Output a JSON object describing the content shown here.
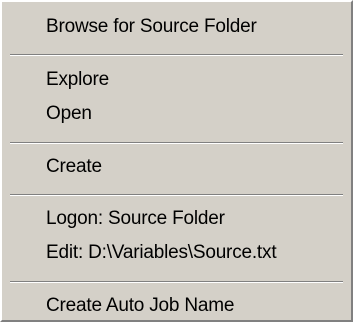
{
  "menu": {
    "items": [
      {
        "label": "Browse for Source Folder"
      },
      {
        "label": "Explore"
      },
      {
        "label": "Open"
      },
      {
        "label": "Create"
      },
      {
        "label": "Logon: Source Folder"
      },
      {
        "label": "Edit: D:\\Variables\\Source.txt"
      },
      {
        "label": "Create Auto Job Name"
      }
    ]
  }
}
